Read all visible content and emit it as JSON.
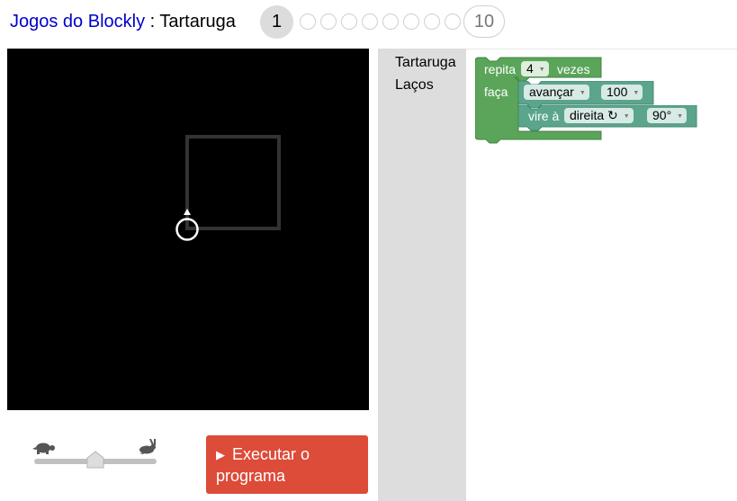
{
  "header": {
    "app_link": "Jogos do Blockly",
    "separator": " : ",
    "game_name": "Tartaruga",
    "level_current": "1",
    "level_last": "10"
  },
  "speed": {
    "slow_icon": "turtle-icon",
    "fast_icon": "rabbit-icon"
  },
  "run_button": {
    "icon": "play-icon",
    "label_line1": "Executar o",
    "label_line2": "programa"
  },
  "toolbox": {
    "categories": [
      "Tartaruga",
      "Laços"
    ]
  },
  "workspace": {
    "repeat_block": {
      "label": "repita",
      "count": "4",
      "suffix": "vezes",
      "do_label": "faça"
    },
    "move_block": {
      "direction": "avançar",
      "distance": "100"
    },
    "turn_block": {
      "label": "vire à",
      "direction": "direita ↻",
      "angle": "90°"
    }
  },
  "colors": {
    "loop_block": "#5ba55b",
    "turtle_block": "#5ba58c",
    "run_button": "#dd4b39",
    "toolbox_bg": "#dddddd",
    "canvas_bg": "#000000"
  }
}
